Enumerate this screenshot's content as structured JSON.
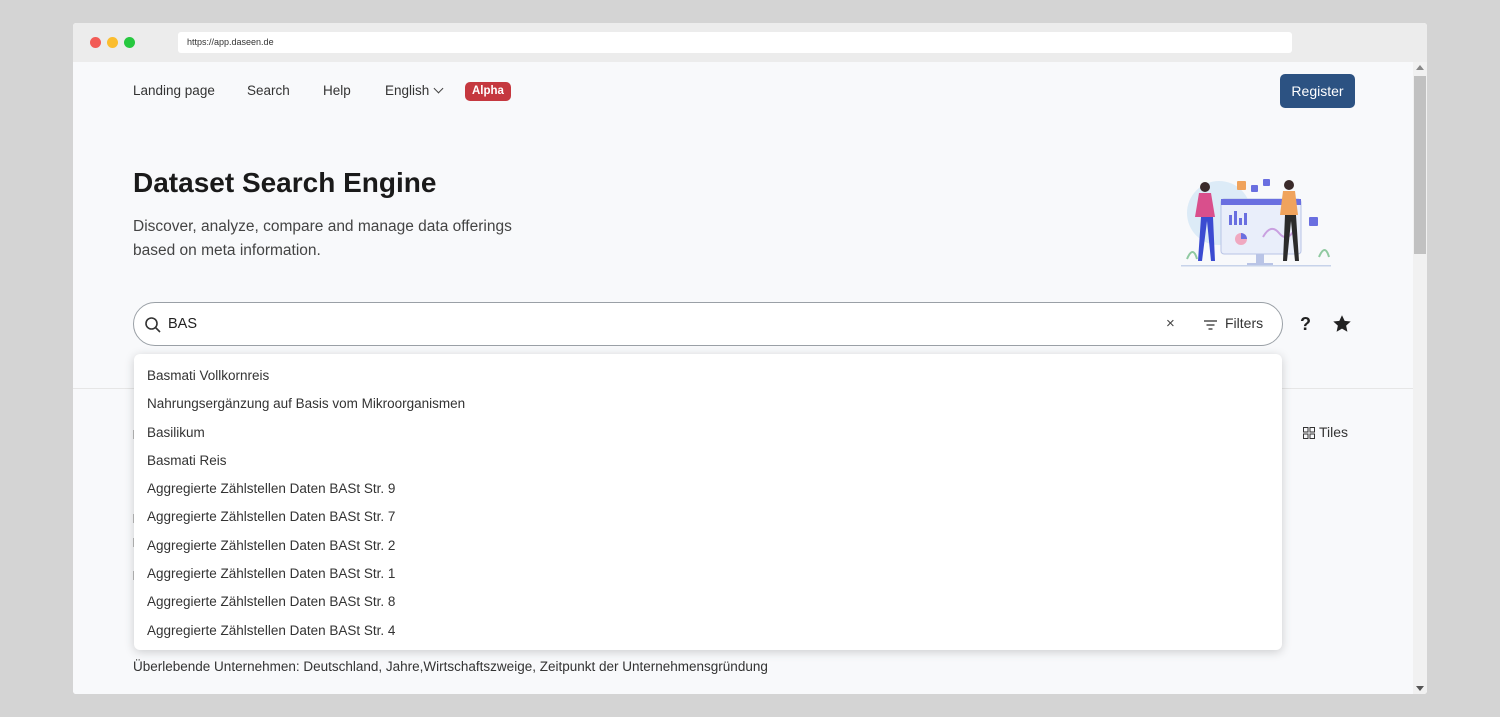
{
  "browser": {
    "url": "https://app.daseen.de"
  },
  "nav": {
    "items": [
      "Landing page",
      "Search",
      "Help",
      "English"
    ],
    "badge": "Alpha",
    "register": "Register"
  },
  "hero": {
    "title": "Dataset Search Engine",
    "subtitle": "Discover, analyze, compare and manage data offerings based on meta information."
  },
  "search": {
    "value": "BAS",
    "clear": "×",
    "filters": "Filters",
    "help": "?"
  },
  "dropdown": {
    "items": [
      "Basmati Vollkornreis",
      "Nahrungsergänzung auf Basis vom Mikroorganismen",
      "Basilikum",
      "Basmati Reis",
      "Aggregierte Zählstellen Daten BASt Str. 9",
      "Aggregierte Zählstellen Daten BASt Str. 7",
      "Aggregierte Zählstellen Daten BASt Str. 2",
      "Aggregierte Zählstellen Daten BASt Str. 1",
      "Aggregierte Zählstellen Daten BASt Str. 8",
      "Aggregierte Zählstellen Daten BASt Str. 4"
    ]
  },
  "results": {
    "view_toggle": "Tiles",
    "visible_result": "Überlebende Unternehmen: Deutschland, Jahre,Wirtschaftszweige, Zeitpunkt der Unternehmensgründung"
  },
  "colors": {
    "primary": "#2c5282",
    "badge": "#c5383f",
    "page_bg": "#f8f9fb"
  }
}
